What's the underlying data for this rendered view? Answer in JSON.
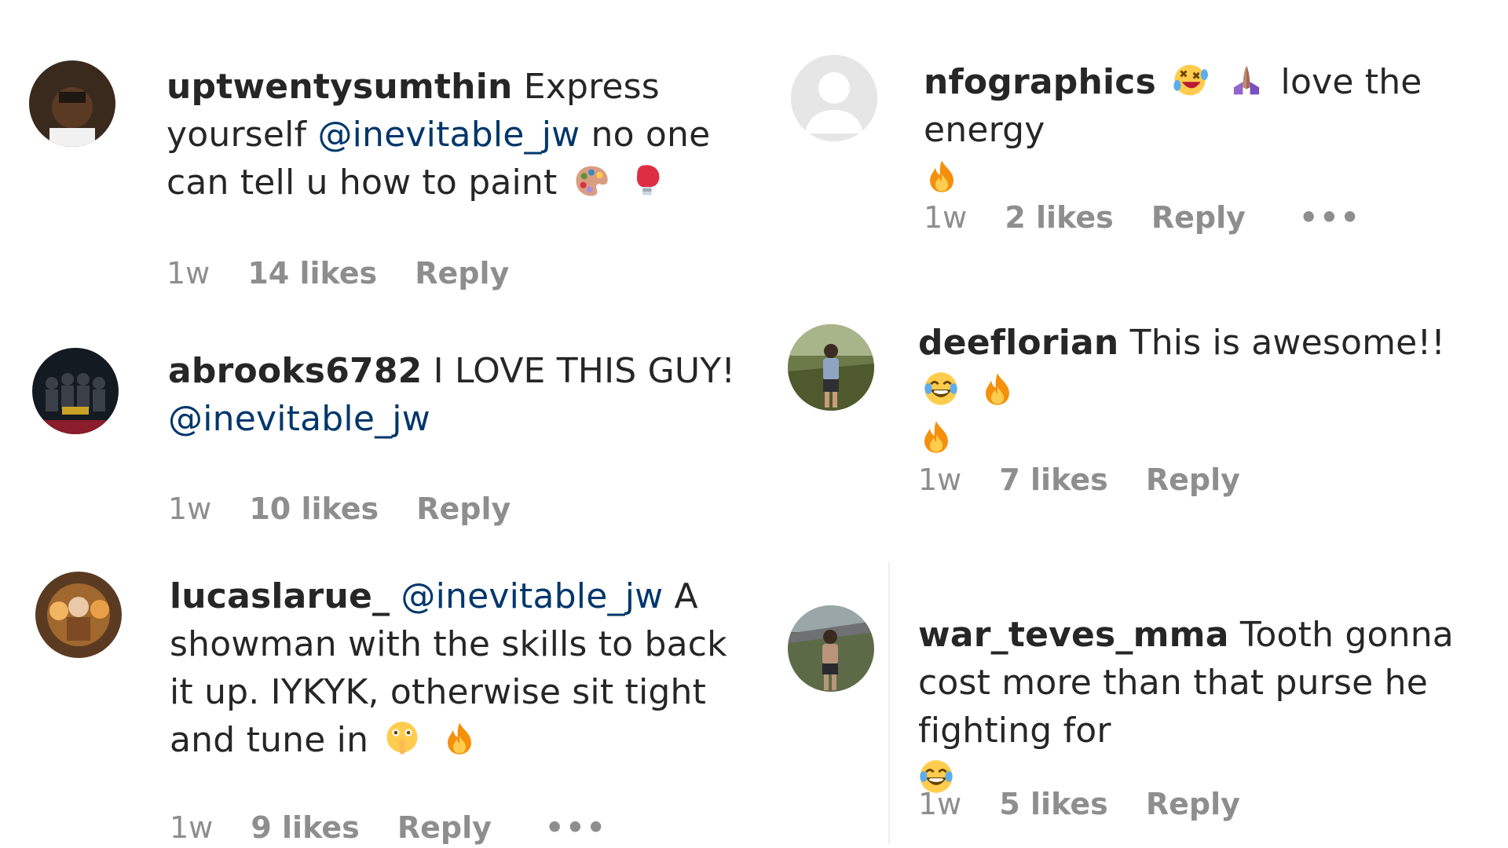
{
  "comments": [
    {
      "username": "uptwentysumthin",
      "text_before": "Express yourself",
      "mention": "@inevitable_jw",
      "text_after": "no one can tell u how to paint",
      "emojis": [
        "artist-palette",
        "boxing-glove"
      ],
      "time": "1w",
      "likes": "14 likes",
      "reply": "Reply"
    },
    {
      "username": "abrooks6782",
      "text_before": "I LOVE THIS GUY!",
      "mention": "@inevitable_jw",
      "text_after": "",
      "time": "1w",
      "likes": "10 likes",
      "reply": "Reply"
    },
    {
      "username": "lucaslarue_",
      "text_before": "",
      "mention": "@inevitable_jw",
      "text_after": "A showman with the skills to back it up. IYKYK, otherwise sit tight and tune in",
      "emojis": [
        "shushing-face",
        "fire"
      ],
      "time": "1w",
      "likes": "9 likes",
      "reply": "Reply",
      "more": "•••"
    },
    {
      "username": "nfographics",
      "text_after": "love the energy",
      "emojis": [
        "rolling-laughing-face",
        "folded-hands",
        "fire"
      ],
      "time": "1w",
      "likes": "2 likes",
      "reply": "Reply",
      "more": "•••"
    },
    {
      "username": "deeflorian",
      "text_before": "This is awesome!!",
      "emojis": [
        "tears-of-joy",
        "fire",
        "fire"
      ],
      "time": "1w",
      "likes": "7 likes",
      "reply": "Reply"
    },
    {
      "username": "war_teves_mma",
      "text_before": "Tooth gonna cost more than that purse he fighting for",
      "emojis": [
        "tears-of-joy"
      ],
      "time": "1w",
      "likes": "5 likes",
      "reply": "Reply"
    }
  ]
}
